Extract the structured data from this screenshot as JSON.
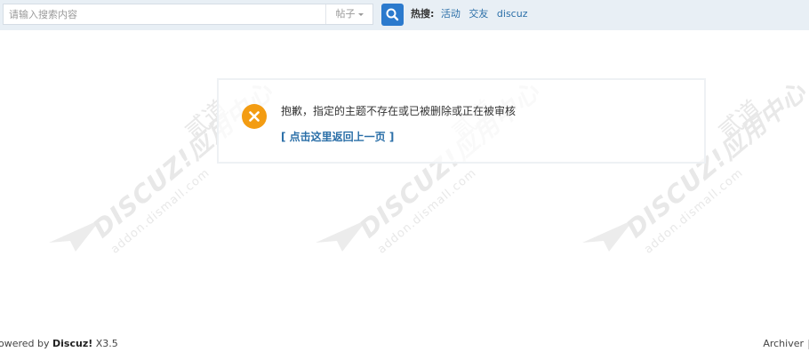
{
  "search": {
    "placeholder": "请输入搜索内容",
    "type_selected": "帖子"
  },
  "hot_search": {
    "label": "热搜:",
    "links": [
      "活动",
      "交友",
      "discuz"
    ]
  },
  "watermark": {
    "brand": "DISCUZ!应用中心",
    "url": "addon.dismall.com",
    "tag": "贰道"
  },
  "message": {
    "text": "抱歉，指定的主题不存在或已被删除或正在被审核",
    "back_link": "[ 点击这里返回上一页 ]"
  },
  "footer": {
    "powered_prefix": "owered by ",
    "powered_brand": "Discuz!",
    "powered_version": " X3.5",
    "archiver": "Archiver"
  },
  "colors": {
    "topbar_bg": "#e8eff5",
    "accent_blue": "#2b7acd",
    "error_orange": "#f39c12",
    "link_blue": "#2b6fa8"
  }
}
